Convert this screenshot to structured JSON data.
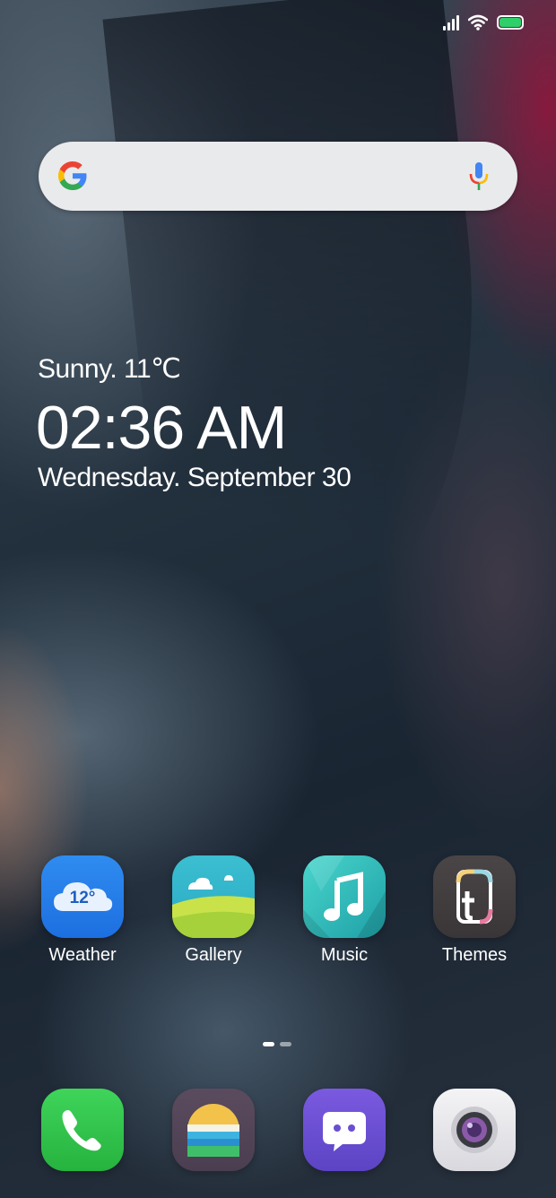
{
  "status_bar": {
    "icons": [
      "signal-icon",
      "wifi-icon",
      "battery-icon"
    ],
    "battery_color": "#2fd06a"
  },
  "search_bar": {
    "icons": [
      "google-logo-icon",
      "microphone-icon"
    ]
  },
  "clock_widget": {
    "weather": "Sunny. 11℃",
    "time": "02:36 AM",
    "date": "Wednesday. September 30"
  },
  "apps": [
    {
      "label": "Weather",
      "icon": "weather-app-icon",
      "icon_text": "12°"
    },
    {
      "label": "Gallery",
      "icon": "gallery-app-icon"
    },
    {
      "label": "Music",
      "icon": "music-app-icon"
    },
    {
      "label": "Themes",
      "icon": "themes-app-icon"
    }
  ],
  "page_indicator": {
    "pages": 2,
    "current": 1
  },
  "dock": [
    {
      "icon": "phone-icon",
      "color": "#2fc24a"
    },
    {
      "icon": "browser-icon",
      "color": "#5a4a5e"
    },
    {
      "icon": "messages-icon",
      "color": "#6a4fd0"
    },
    {
      "icon": "camera-icon",
      "color": "#e8e8ec"
    }
  ]
}
